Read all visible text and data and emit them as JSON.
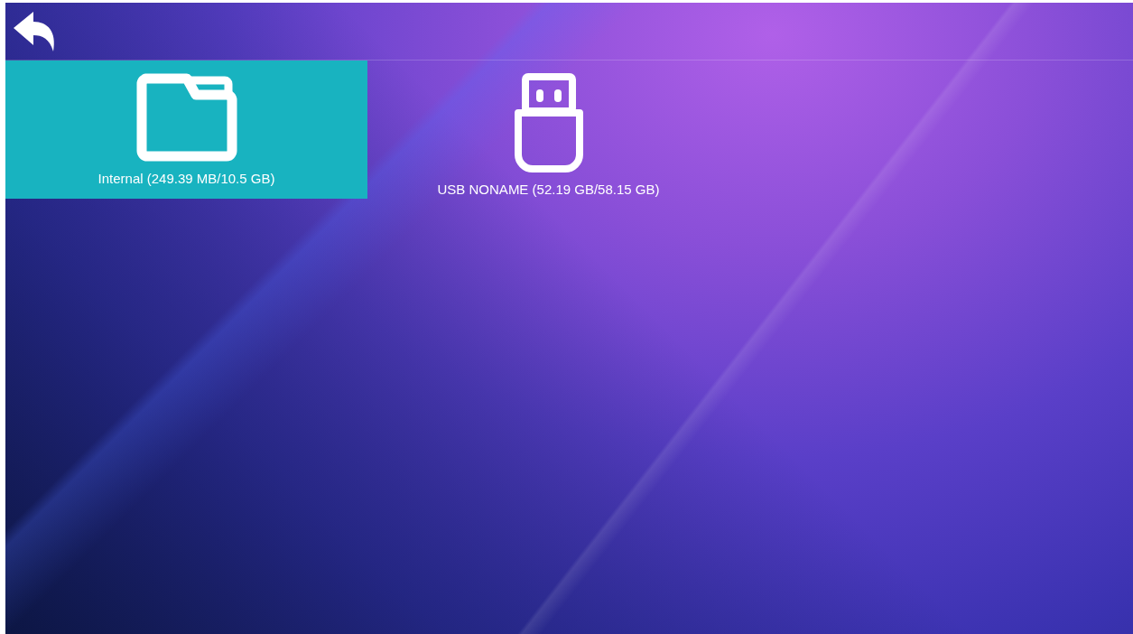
{
  "devices": [
    {
      "kind": "folder",
      "label": "Internal (249.39 MB/10.5 GB)",
      "selected": true
    },
    {
      "kind": "usb",
      "label": "USB NONAME (52.19 GB/58.15 GB)",
      "selected": false
    }
  ]
}
